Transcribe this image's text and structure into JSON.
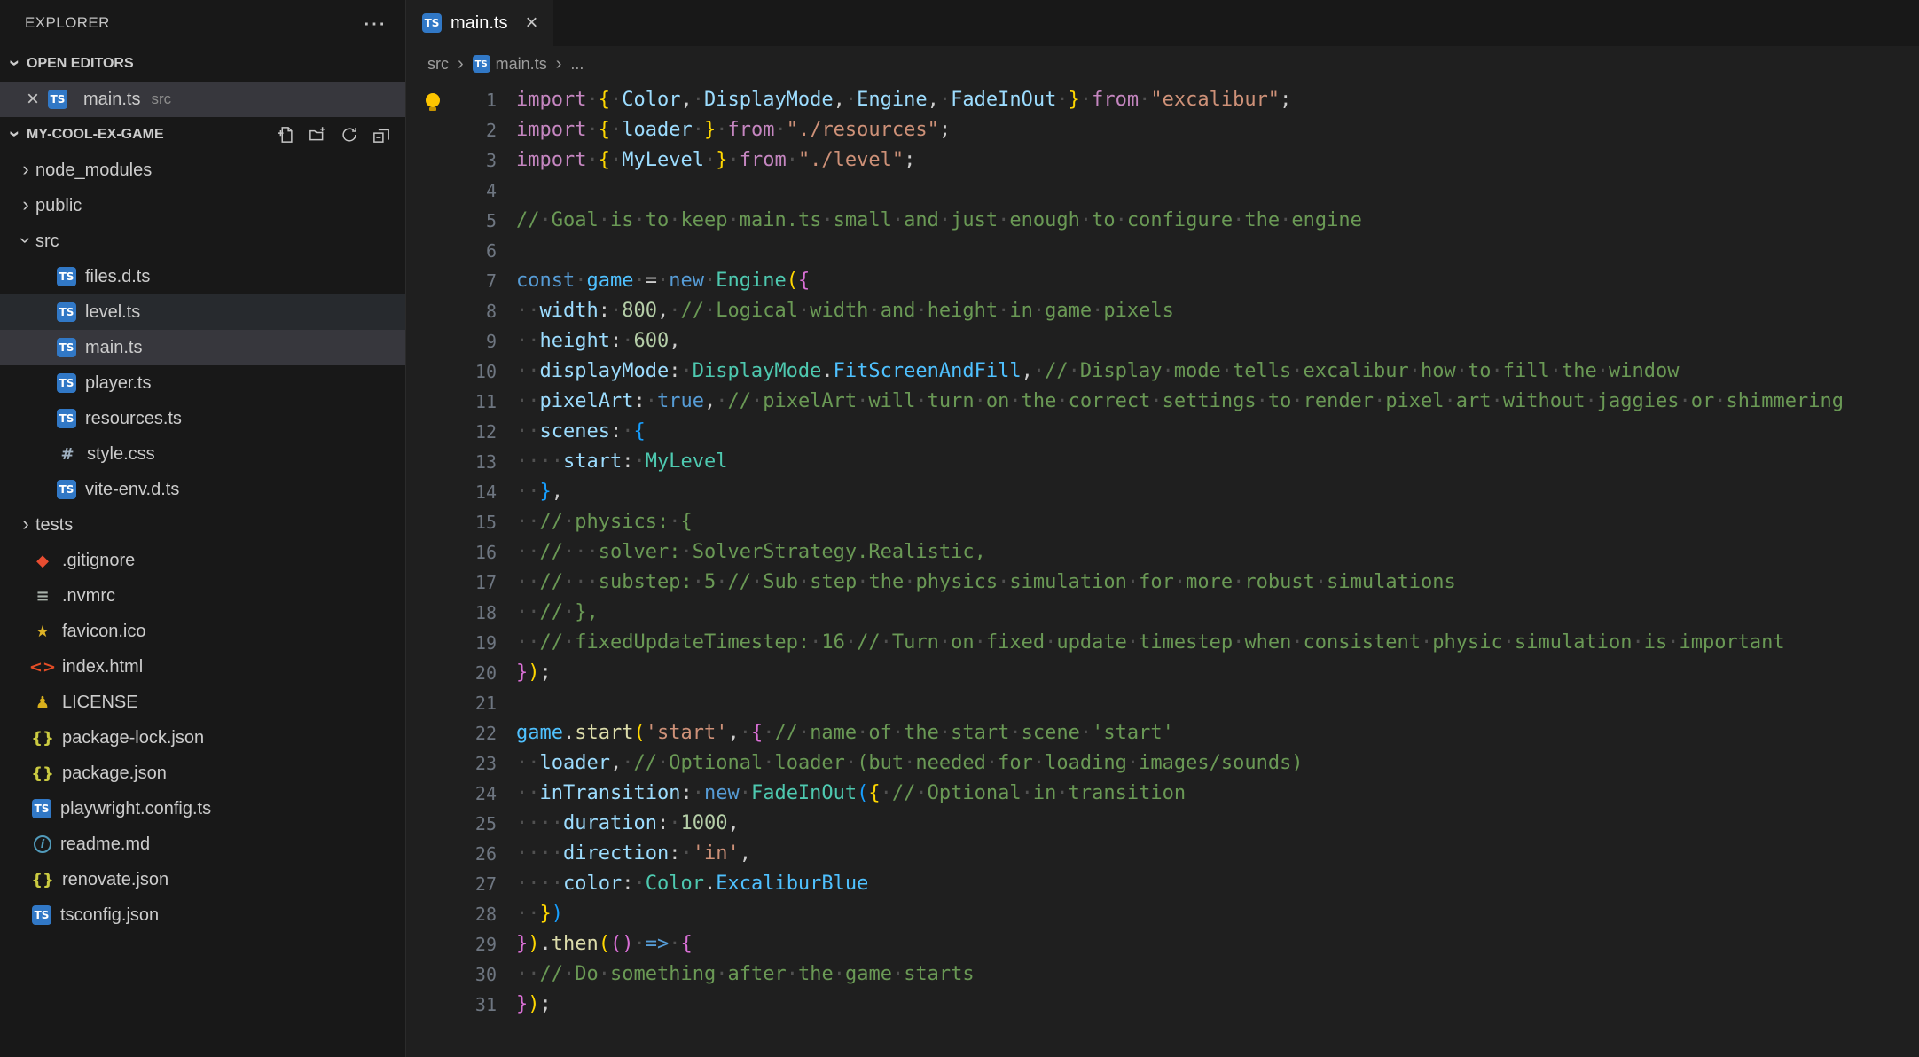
{
  "theme": {
    "editor_bg": "#1f1f1f",
    "sidebar_bg": "#181818",
    "selection_bg": "#37373d",
    "ts_icon_blue": "#3178c6",
    "comment_green": "#6A9955",
    "lightbulb_yellow": "#fdc500"
  },
  "icons": {
    "chevron": {
      "glyph": "›"
    },
    "more": {
      "glyph": "⋯"
    },
    "close": {
      "glyph": "×"
    },
    "ts": {
      "glyph": "TS",
      "color": "#ffffff",
      "bg": "#3178c6"
    },
    "tsconfig": {
      "glyph": "TS",
      "color": "#ffffff",
      "bg": "#3178c6"
    },
    "css": {
      "glyph": "#",
      "color": "#9fb0c0"
    },
    "git": {
      "glyph": "◆",
      "color": "#e84d31"
    },
    "config": {
      "glyph": "≡",
      "color": "#a9b2ab"
    },
    "star": {
      "glyph": "★",
      "color": "#ddb226"
    },
    "html": {
      "glyph": "<>",
      "color": "#e44d26"
    },
    "license": {
      "glyph": "♟",
      "color": "#d9b01c"
    },
    "json": {
      "glyph": "{}",
      "color": "#cbcb41"
    },
    "info": {
      "glyph": "i",
      "color": "#519aba"
    }
  },
  "explorer": {
    "title": "EXPLORER",
    "more_actions": "⋯",
    "open_editors": {
      "label": "OPEN EDITORS",
      "items": [
        {
          "name": "main.ts",
          "detail": "src",
          "icon": "ts",
          "close": "×"
        }
      ]
    },
    "project": {
      "label": "MY-COOL-EX-GAME",
      "actions": [
        "new-file",
        "new-folder",
        "refresh",
        "collapse-all"
      ],
      "tree": [
        {
          "depth": 0,
          "chevron": "collapsed",
          "kind": "folder",
          "label": "node_modules"
        },
        {
          "depth": 0,
          "chevron": "collapsed",
          "kind": "folder",
          "label": "public"
        },
        {
          "depth": 0,
          "chevron": "expanded",
          "kind": "folder",
          "label": "src"
        },
        {
          "depth": 1,
          "icon": "ts",
          "label": "files.d.ts"
        },
        {
          "depth": 1,
          "icon": "ts",
          "label": "level.ts",
          "state": "hover"
        },
        {
          "depth": 1,
          "icon": "ts",
          "label": "main.ts",
          "state": "selected"
        },
        {
          "depth": 1,
          "icon": "ts",
          "label": "player.ts"
        },
        {
          "depth": 1,
          "icon": "ts",
          "label": "resources.ts"
        },
        {
          "depth": 1,
          "icon": "css",
          "label": "style.css"
        },
        {
          "depth": 1,
          "icon": "ts",
          "label": "vite-env.d.ts"
        },
        {
          "depth": 0,
          "chevron": "collapsed",
          "kind": "folder",
          "label": "tests"
        },
        {
          "depth": 0,
          "icon": "git",
          "label": ".gitignore"
        },
        {
          "depth": 0,
          "icon": "config",
          "label": ".nvmrc"
        },
        {
          "depth": 0,
          "icon": "star",
          "label": "favicon.ico"
        },
        {
          "depth": 0,
          "icon": "html",
          "label": "index.html"
        },
        {
          "depth": 0,
          "icon": "license",
          "label": "LICENSE"
        },
        {
          "depth": 0,
          "icon": "json",
          "label": "package-lock.json"
        },
        {
          "depth": 0,
          "icon": "json",
          "label": "package.json"
        },
        {
          "depth": 0,
          "icon": "ts",
          "label": "playwright.config.ts"
        },
        {
          "depth": 0,
          "icon": "info",
          "label": "readme.md"
        },
        {
          "depth": 0,
          "icon": "json",
          "label": "renovate.json"
        },
        {
          "depth": 0,
          "icon": "tsconfig",
          "label": "tsconfig.json"
        }
      ]
    }
  },
  "editor": {
    "tab": {
      "label": "main.ts",
      "icon": "ts",
      "close": "×"
    },
    "breadcrumbs": [
      {
        "label": "src"
      },
      {
        "label": "main.ts",
        "icon": "ts"
      },
      {
        "label": "..."
      }
    ],
    "lightbulb_line": 1,
    "code": {
      "language": "typescript",
      "lines": [
        [
          [
            "kw1",
            "import"
          ],
          [
            "pun",
            " "
          ],
          [
            "b1",
            "{"
          ],
          [
            "pun",
            " "
          ],
          [
            "var",
            "Color"
          ],
          [
            "pun",
            ", "
          ],
          [
            "var",
            "DisplayMode"
          ],
          [
            "pun",
            ", "
          ],
          [
            "var",
            "Engine"
          ],
          [
            "pun",
            ", "
          ],
          [
            "var",
            "FadeInOut"
          ],
          [
            "pun",
            " "
          ],
          [
            "b1",
            "}"
          ],
          [
            "pun",
            " "
          ],
          [
            "kw1",
            "from"
          ],
          [
            "pun",
            " "
          ],
          [
            "str",
            "\"excalibur\""
          ],
          [
            "pun",
            ";"
          ]
        ],
        [
          [
            "kw1",
            "import"
          ],
          [
            "pun",
            " "
          ],
          [
            "b1",
            "{"
          ],
          [
            "pun",
            " "
          ],
          [
            "var",
            "loader"
          ],
          [
            "pun",
            " "
          ],
          [
            "b1",
            "}"
          ],
          [
            "pun",
            " "
          ],
          [
            "kw1",
            "from"
          ],
          [
            "pun",
            " "
          ],
          [
            "str",
            "\"./resources\""
          ],
          [
            "pun",
            ";"
          ]
        ],
        [
          [
            "kw1",
            "import"
          ],
          [
            "pun",
            " "
          ],
          [
            "b1",
            "{"
          ],
          [
            "pun",
            " "
          ],
          [
            "var",
            "MyLevel"
          ],
          [
            "pun",
            " "
          ],
          [
            "b1",
            "}"
          ],
          [
            "pun",
            " "
          ],
          [
            "kw1",
            "from"
          ],
          [
            "pun",
            " "
          ],
          [
            "str",
            "\"./level\""
          ],
          [
            "pun",
            ";"
          ]
        ],
        [],
        [
          [
            "cmt",
            "// Goal is to keep main.ts small and just enough to configure the engine"
          ]
        ],
        [],
        [
          [
            "kw2",
            "const"
          ],
          [
            "pun",
            " "
          ],
          [
            "cvar",
            "game"
          ],
          [
            "pun",
            " = "
          ],
          [
            "kw2",
            "new"
          ],
          [
            "pun",
            " "
          ],
          [
            "type",
            "Engine"
          ],
          [
            "b1",
            "("
          ],
          [
            "b2",
            "{"
          ]
        ],
        [
          [
            "pun",
            "  "
          ],
          [
            "var",
            "width"
          ],
          [
            "pun",
            ": "
          ],
          [
            "num",
            "800"
          ],
          [
            "pun",
            ", "
          ],
          [
            "cmt",
            "// Logical width and height in game pixels"
          ]
        ],
        [
          [
            "pun",
            "  "
          ],
          [
            "var",
            "height"
          ],
          [
            "pun",
            ": "
          ],
          [
            "num",
            "600"
          ],
          [
            "pun",
            ","
          ]
        ],
        [
          [
            "pun",
            "  "
          ],
          [
            "var",
            "displayMode"
          ],
          [
            "pun",
            ": "
          ],
          [
            "type",
            "DisplayMode"
          ],
          [
            "pun",
            "."
          ],
          [
            "cvar",
            "FitScreenAndFill"
          ],
          [
            "pun",
            ", "
          ],
          [
            "cmt",
            "// Display mode tells excalibur how to fill the window"
          ]
        ],
        [
          [
            "pun",
            "  "
          ],
          [
            "var",
            "pixelArt"
          ],
          [
            "pun",
            ": "
          ],
          [
            "kw2",
            "true"
          ],
          [
            "pun",
            ", "
          ],
          [
            "cmt",
            "// pixelArt will turn on the correct settings to render pixel art without jaggies or shimmering"
          ]
        ],
        [
          [
            "pun",
            "  "
          ],
          [
            "var",
            "scenes"
          ],
          [
            "pun",
            ": "
          ],
          [
            "b3",
            "{"
          ]
        ],
        [
          [
            "pun",
            "    "
          ],
          [
            "var",
            "start"
          ],
          [
            "pun",
            ": "
          ],
          [
            "type",
            "MyLevel"
          ]
        ],
        [
          [
            "pun",
            "  "
          ],
          [
            "b3",
            "}"
          ],
          [
            "pun",
            ","
          ]
        ],
        [
          [
            "pun",
            "  "
          ],
          [
            "cmt",
            "// physics: {"
          ]
        ],
        [
          [
            "pun",
            "  "
          ],
          [
            "cmt",
            "//   solver: SolverStrategy.Realistic,"
          ]
        ],
        [
          [
            "pun",
            "  "
          ],
          [
            "cmt",
            "//   substep: 5 // Sub step the physics simulation for more robust simulations"
          ]
        ],
        [
          [
            "pun",
            "  "
          ],
          [
            "cmt",
            "// },"
          ]
        ],
        [
          [
            "pun",
            "  "
          ],
          [
            "cmt",
            "// fixedUpdateTimestep: 16 // Turn on fixed update timestep when consistent physic simulation is important"
          ]
        ],
        [
          [
            "b2",
            "}"
          ],
          [
            "b1",
            ")"
          ],
          [
            "pun",
            ";"
          ]
        ],
        [],
        [
          [
            "cvar",
            "game"
          ],
          [
            "pun",
            "."
          ],
          [
            "fn",
            "start"
          ],
          [
            "b1",
            "("
          ],
          [
            "str",
            "'start'"
          ],
          [
            "pun",
            ", "
          ],
          [
            "b2",
            "{"
          ],
          [
            "pun",
            " "
          ],
          [
            "cmt",
            "// name of the start scene 'start'"
          ]
        ],
        [
          [
            "pun",
            "  "
          ],
          [
            "var",
            "loader"
          ],
          [
            "pun",
            ", "
          ],
          [
            "cmt",
            "// Optional loader (but needed for loading images/sounds)"
          ]
        ],
        [
          [
            "pun",
            "  "
          ],
          [
            "var",
            "inTransition"
          ],
          [
            "pun",
            ": "
          ],
          [
            "kw2",
            "new"
          ],
          [
            "pun",
            " "
          ],
          [
            "type",
            "FadeInOut"
          ],
          [
            "b3",
            "("
          ],
          [
            "b1",
            "{"
          ],
          [
            "pun",
            " "
          ],
          [
            "cmt",
            "// Optional in transition"
          ]
        ],
        [
          [
            "pun",
            "    "
          ],
          [
            "var",
            "duration"
          ],
          [
            "pun",
            ": "
          ],
          [
            "num",
            "1000"
          ],
          [
            "pun",
            ","
          ]
        ],
        [
          [
            "pun",
            "    "
          ],
          [
            "var",
            "direction"
          ],
          [
            "pun",
            ": "
          ],
          [
            "str",
            "'in'"
          ],
          [
            "pun",
            ","
          ]
        ],
        [
          [
            "pun",
            "    "
          ],
          [
            "var",
            "color"
          ],
          [
            "pun",
            ": "
          ],
          [
            "type",
            "Color"
          ],
          [
            "pun",
            "."
          ],
          [
            "cvar",
            "ExcaliburBlue"
          ]
        ],
        [
          [
            "pun",
            "  "
          ],
          [
            "b1",
            "}"
          ],
          [
            "b3",
            ")"
          ]
        ],
        [
          [
            "b2",
            "}"
          ],
          [
            "b1",
            ")"
          ],
          [
            "pun",
            "."
          ],
          [
            "fn",
            "then"
          ],
          [
            "b1",
            "("
          ],
          [
            "b2",
            "("
          ],
          [
            "b2",
            ")"
          ],
          [
            "pun",
            " "
          ],
          [
            "kw2",
            "=>"
          ],
          [
            "pun",
            " "
          ],
          [
            "b2",
            "{"
          ]
        ],
        [
          [
            "pun",
            "  "
          ],
          [
            "cmt",
            "// Do something after the game starts"
          ]
        ],
        [
          [
            "b2",
            "}"
          ],
          [
            "b1",
            ")"
          ],
          [
            "pun",
            ";"
          ]
        ]
      ]
    }
  }
}
